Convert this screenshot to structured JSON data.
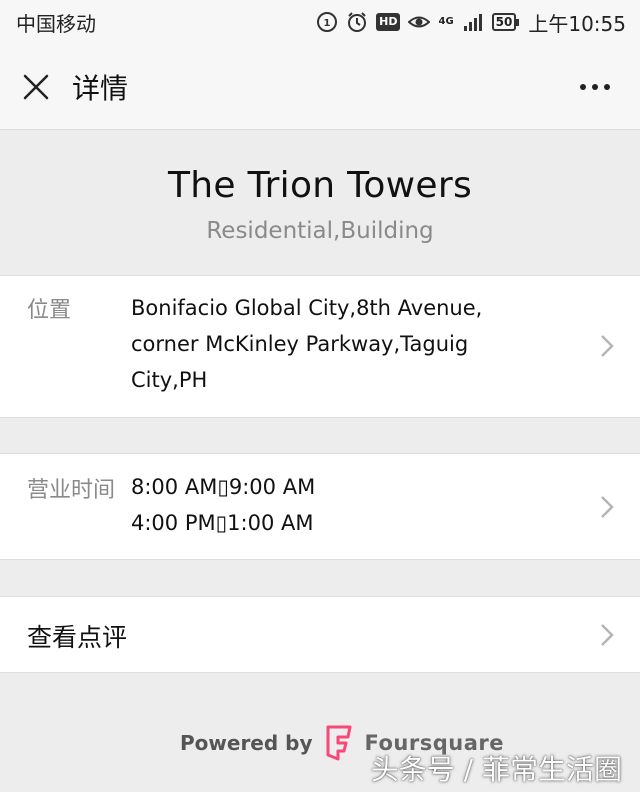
{
  "status_bar": {
    "carrier": "中国移动",
    "hd_badge": "HD",
    "network": "4G",
    "battery": "50",
    "time": "上午10:55"
  },
  "nav": {
    "title": "详情",
    "close_icon": "close-icon",
    "more_icon": "more-icon"
  },
  "place": {
    "name": "The Trion Towers",
    "category": "Residential,Building"
  },
  "location": {
    "label": "位置",
    "lines": [
      "Bonifacio Global City,8th Avenue,",
      "corner McKinley Parkway,Taguig",
      "City,PH"
    ]
  },
  "hours": {
    "label": "营业时间",
    "lines": [
      "8:00 AM▯9:00 AM",
      "4:00 PM▯1:00 AM"
    ]
  },
  "reviews": {
    "label": "查看点评"
  },
  "footer": {
    "powered_by": "Powered by",
    "brand": "Foursquare",
    "brand_color": "#f94877"
  },
  "watermark": "头条号 / 菲常生活圈"
}
